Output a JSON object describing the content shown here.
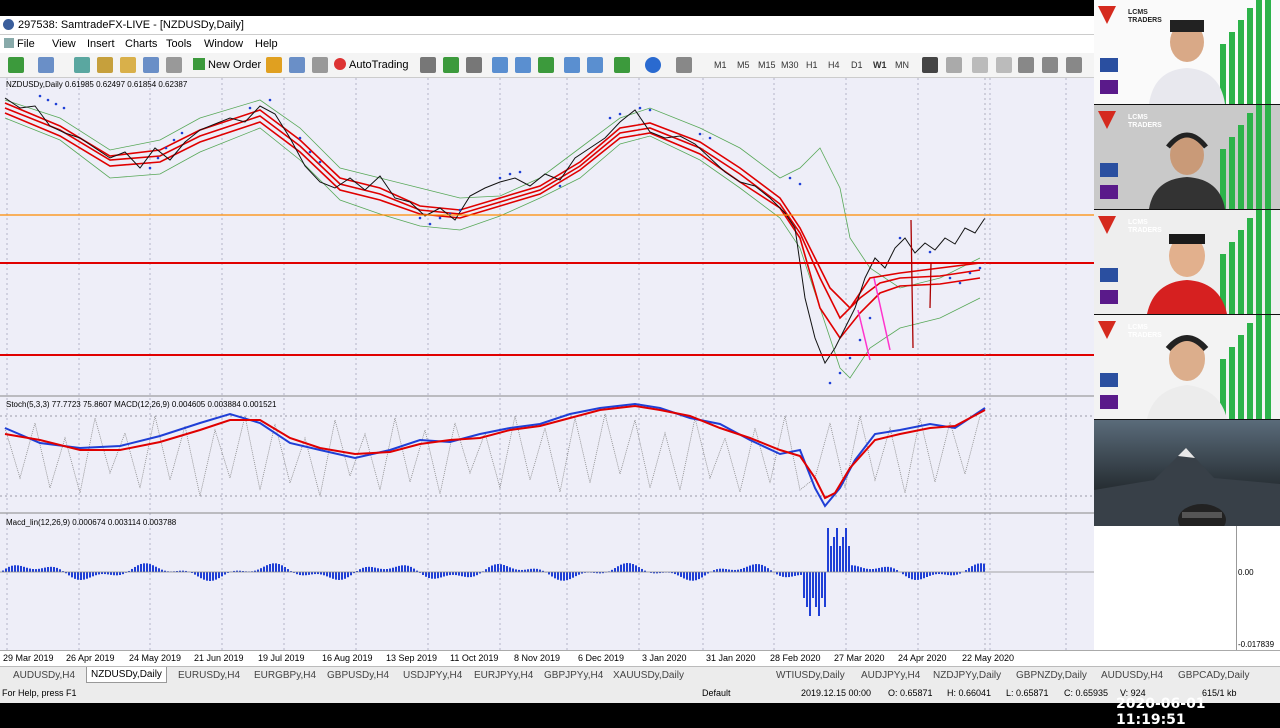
{
  "window": {
    "title": "297538: SamtradeFX-LIVE - [NZDUSDy,Daily]"
  },
  "menu": [
    "File",
    "View",
    "Insert",
    "Charts",
    "Tools",
    "Window",
    "Help"
  ],
  "toolbar": {
    "new_order": "New Order",
    "autotrading": "AutoTrading",
    "timeframes": [
      "M1",
      "M5",
      "M15",
      "M30",
      "H1",
      "H4",
      "D1",
      "W1",
      "MN"
    ]
  },
  "chart": {
    "main_header": "NZDUSDy,Daily  0.61985 0.62497 0.61854 0.62387",
    "stoch_header": "Stoch(5,3,3) 77.7723 75.8607  MACD(12,26,9) 0.004605 0.003884 0.001521",
    "macd_header": "Macd_lin(12,26,9) 0.000674 0.003114 0.003788",
    "macd_axis": [
      "0.00",
      "-0.017839"
    ]
  },
  "dates": [
    "29 Mar 2019",
    "26 Apr 2019",
    "24 May 2019",
    "21 Jun 2019",
    "19 Jul 2019",
    "16 Aug 2019",
    "13 Sep 2019",
    "11 Oct 2019",
    "8 Nov 2019",
    "6 Dec 2019",
    "3 Jan 2020",
    "31 Jan 2020",
    "28 Feb 2020",
    "27 Mar 2020",
    "24 Apr 2020",
    "22 May 2020"
  ],
  "tabs": [
    "AUDUSDy,H4",
    "NZDUSDy,Daily",
    "EURUSDy,H4",
    "EURGBPy,H4",
    "GBPUSDy,H4",
    "USDJPYy,H4",
    "EURJPYy,H4",
    "GBPJPYy,H4",
    "XAUUSDy,Daily",
    "WTIUSDy,Daily",
    "AUDJPYy,H4",
    "NZDJPYy,Daily",
    "GBPNZDy,Daily",
    "AUDUSDy,H4",
    "GBPCADy,Daily"
  ],
  "active_tab": 1,
  "status": {
    "help": "For Help, press F1",
    "profile": "Default",
    "datetime": "2019.12.15 00:00",
    "open": "O: 0.65871",
    "high": "H: 0.66041",
    "low": "L: 0.65871",
    "close": "C: 0.65935",
    "volume": "V: 924",
    "traffic": "615/1 kb"
  },
  "overlay": {
    "timestamp": "2020-06-01 11:19:51",
    "brand_line1": "LCMS",
    "brand_line2": "TRADERS"
  },
  "colors": {
    "chart_bg": "#eeeef8",
    "red_line": "#e00000",
    "orange_line": "#ff8c00",
    "blue": "#1f3fd6",
    "magenta": "#ff33cc",
    "green": "#2db34a"
  }
}
